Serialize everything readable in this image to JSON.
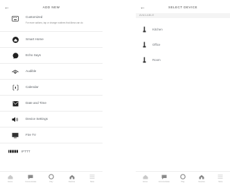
{
  "left": {
    "title": "ADD NEW",
    "back_icon": "arrow-left-icon",
    "items": [
      {
        "label": "Customized",
        "sublabel": "For more actions, tap or change routines that Alexa can do",
        "icon": "keyboard-icon"
      },
      {
        "label": "Smart Home",
        "icon": "smart-home-icon"
      },
      {
        "label": "Echo Says",
        "icon": "speech-bubble-icon"
      },
      {
        "label": "Audible",
        "icon": "audible-icon"
      },
      {
        "label": "Calendar",
        "icon": "calendar-icon"
      },
      {
        "label": "Date and Time",
        "icon": "clock-icon"
      },
      {
        "label": "Device Settings",
        "icon": "speaker-icon"
      },
      {
        "label": "Fire TV",
        "icon": "tv-icon"
      },
      {
        "label": "IFTTT",
        "icon": "ifttt-icon"
      }
    ]
  },
  "right": {
    "title": "SELECT DEVICE",
    "back_icon": "arrow-left-icon",
    "section_label": "AVAILABLE",
    "devices": [
      {
        "label": "Kitchen",
        "icon": "device-icon"
      },
      {
        "label": "Office",
        "icon": "device-icon"
      },
      {
        "label": "Room",
        "icon": "device-icon"
      }
    ]
  },
  "nav": [
    {
      "label": "Home",
      "icon": "home-icon"
    },
    {
      "label": "Communicate",
      "icon": "chat-icon"
    },
    {
      "label": "Play",
      "icon": "play-icon"
    },
    {
      "label": "Devices",
      "icon": "devices-icon"
    },
    {
      "label": "More",
      "icon": "menu-icon"
    }
  ]
}
